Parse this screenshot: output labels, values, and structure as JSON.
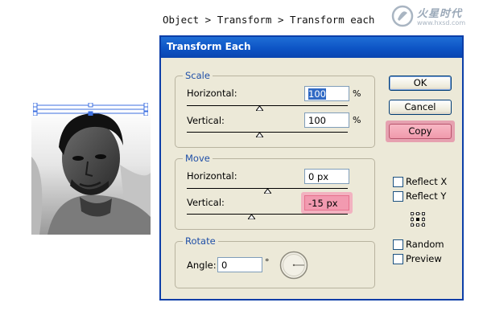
{
  "caption": "Object > Transform > Transform each",
  "watermark": {
    "text": "火星时代",
    "url": "www.hxsd.com"
  },
  "dialog": {
    "title": "Transform Each",
    "scale": {
      "legend": "Scale",
      "horizontal_label": "Horizontal:",
      "horizontal_value": "100",
      "horizontal_unit": "%",
      "horizontal_level": 0.45,
      "vertical_label": "Vertical:",
      "vertical_value": "100",
      "vertical_unit": "%",
      "vertical_level": 0.45
    },
    "move": {
      "legend": "Move",
      "horizontal_label": "Horizontal:",
      "horizontal_value": "0 px",
      "horizontal_level": 0.5,
      "vertical_label": "Vertical:",
      "vertical_value": "-15 px",
      "vertical_level": 0.4
    },
    "rotate": {
      "legend": "Rotate",
      "angle_label": "Angle:",
      "angle_value": "0",
      "angle_unit": "°"
    },
    "buttons": {
      "ok": "OK",
      "cancel": "Cancel",
      "copy": "Copy"
    },
    "options": {
      "reflect_x": {
        "label": "Reflect X",
        "checked": false
      },
      "reflect_y": {
        "label": "Reflect Y",
        "checked": false
      },
      "random": {
        "label": "Random",
        "checked": false
      },
      "preview": {
        "label": "Preview",
        "checked": false
      }
    }
  },
  "colors": {
    "title_bar": "#0d54c5",
    "highlight": "#f29ab0",
    "legend_text": "#1f4fa7",
    "face": "#ece9d8"
  },
  "icons": [
    "reference-point-locator-icon",
    "angle-dial-icon",
    "selection-bounding-box-icon"
  ]
}
